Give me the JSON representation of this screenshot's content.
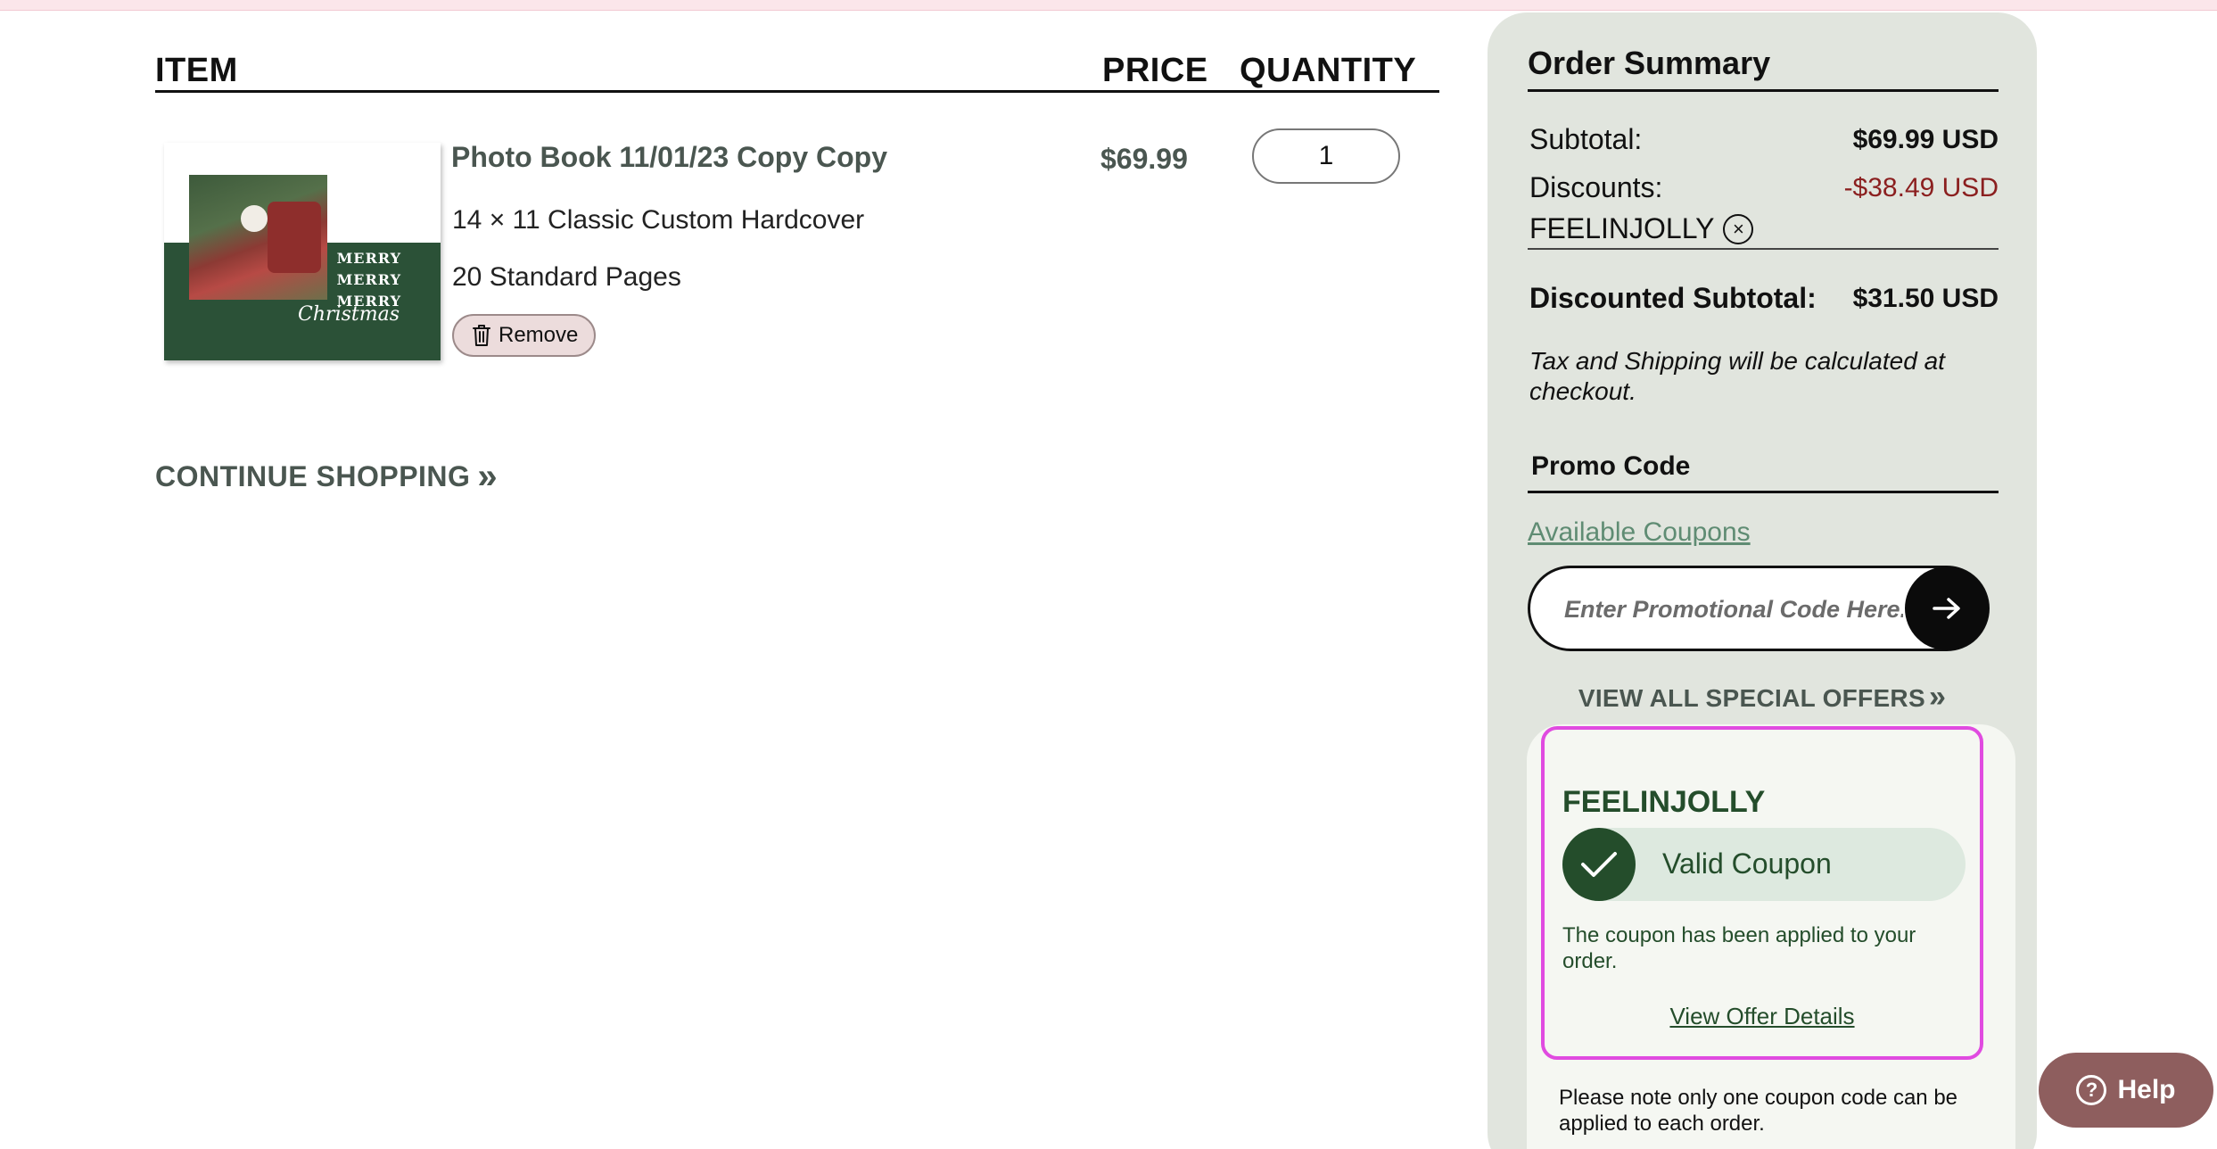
{
  "cart": {
    "headers": {
      "item": "ITEM",
      "price": "PRICE",
      "quantity": "QUANTITY"
    },
    "item": {
      "title": "Photo Book 11/01/23 Copy Copy",
      "size": "14 × 11 Classic Custom Hardcover",
      "pages": "20 Standard Pages",
      "remove_label": "Remove",
      "price": "$69.99",
      "quantity": "1",
      "thumbnail_text": {
        "line1": "MERRY",
        "line2": "MERRY",
        "line3": "MERRY",
        "script": "Christmas"
      }
    },
    "continue_label": "CONTINUE SHOPPING"
  },
  "summary": {
    "title": "Order Summary",
    "subtotal_label": "Subtotal:",
    "subtotal_value": "$69.99 USD",
    "discounts_label": "Discounts:",
    "discounts_value": "-$38.49 USD",
    "applied_code": "FEELINJOLLY",
    "discounted_subtotal_label": "Discounted Subtotal:",
    "discounted_subtotal_value": "$31.50 USD",
    "tax_note": "Tax and Shipping will be calculated at checkout.",
    "promo_title": "Promo Code",
    "available_coupons": "Available Coupons",
    "promo_placeholder": "Enter Promotional Code Here...",
    "view_offers": "VIEW ALL SPECIAL OFFERS",
    "coupon_card": {
      "code": "FEELINJOLLY",
      "status": "Valid Coupon",
      "message": "The coupon has been applied to your order.",
      "details_link": "View Offer Details"
    },
    "one_coupon_note": "Please note only one coupon code can be applied to each order."
  },
  "help": {
    "label": "Help"
  },
  "colors": {
    "summary_bg": "#e1e5de",
    "discount_red": "#8b1f1f",
    "coupon_green": "#244d2b",
    "highlight_magenta": "#e04be0",
    "help_bg": "#8e5e5e"
  },
  "icons": [
    "trash-icon",
    "double-chevron-right-icon",
    "close-circle-icon",
    "arrow-right-icon",
    "checkmark-icon",
    "question-circle-icon"
  ]
}
